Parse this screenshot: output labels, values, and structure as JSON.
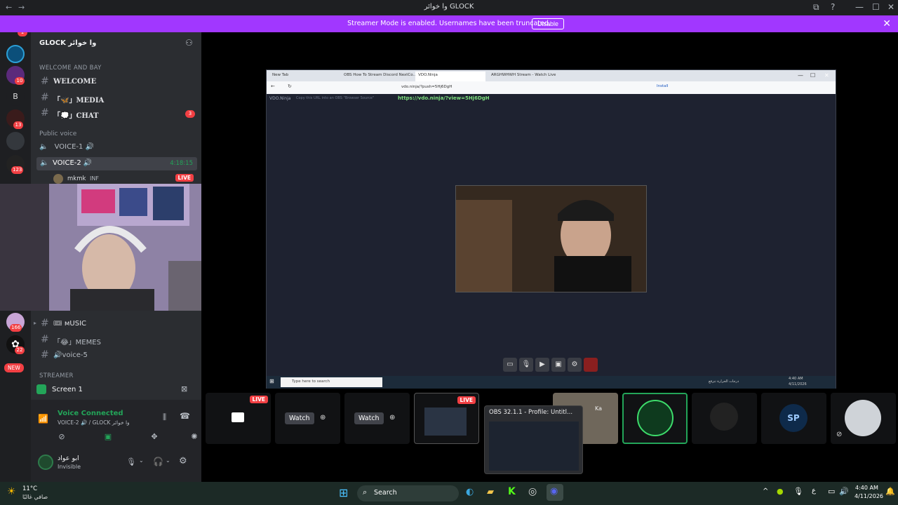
{
  "window": {
    "title": "وا خوائر GLOCK",
    "back": "←",
    "forward": "→",
    "controls": [
      "⧉",
      "?",
      "—",
      "☐",
      "✕"
    ]
  },
  "banner": {
    "message": "Streamer Mode is enabled. Usernames have been truncated.",
    "button": "Disable",
    "close": "✕"
  },
  "rail": {
    "badges": [
      "1",
      "10",
      "13",
      "123",
      "166",
      "22"
    ],
    "letter": "B",
    "new_badge": "NEW"
  },
  "server": {
    "name": "GLOCK وا خوائر",
    "add_icon": "person-add-icon"
  },
  "sidebar": {
    "category1": "WELCOME AND BAY",
    "channels": [
      {
        "label": "WELCOME"
      },
      {
        "label": "「🦋」MEDIA"
      },
      {
        "label": "「💭」CHAT",
        "badge": "3"
      }
    ],
    "category2": "Public voice",
    "voice": [
      {
        "label": "VOICE-1 🔊"
      },
      {
        "label": "VOICE-2 🔊",
        "time": "4:18:15"
      }
    ],
    "member": {
      "name": "mkmk",
      "tag": "INF",
      "live": "LIVE"
    },
    "lower_channels": [
      {
        "label": "🎟 ᴍUSIC"
      },
      {
        "label": "「😂」MEMES"
      },
      {
        "label": "🔊voice-5"
      }
    ],
    "category3": "STREAMER"
  },
  "panel": {
    "screen": "Screen 1",
    "voice_status": "Voice Connected",
    "voice_location": "VOICE-2 🔊 / GLOCK وا خوائر",
    "user_name": "ابو عواد",
    "user_status": "Invisible"
  },
  "browser": {
    "tabs": [
      "New Tab",
      "OBS How To Stream Discord NextCo...",
      "VDO.Ninja",
      "ARGHWHWH Stream - Watch Live"
    ],
    "address": "vdo.ninja/?push=5Hj6DgH",
    "install": "Install",
    "vdo_brand": "VDO.Ninja",
    "vdo_hint": "Copy this URL into an OBS \"Browser Source\"",
    "vdo_link": "https://vdo.ninja/?view=5Hj6DgH",
    "inner_search": "Type here to search",
    "inner_weather": "درجات الحرارة تنزفع",
    "inner_time": "4:40 AM",
    "inner_date": "4/11/2026"
  },
  "tiles": {
    "live": "LIVE",
    "watch": "Watch",
    "obs_title": "OBS 32.1.1 - Profile: Untitl...",
    "ka": "Ka",
    "sp": "SP"
  },
  "taskbar": {
    "weather_temp": "11°C",
    "weather_desc": "صافي غالبًا",
    "search": "Search",
    "lang": "ع",
    "time": "4:40 AM",
    "date": "4/11/2026"
  },
  "colors": {
    "banner": "#a137ff",
    "live": "#f23f43",
    "voice_green": "#23a559"
  }
}
